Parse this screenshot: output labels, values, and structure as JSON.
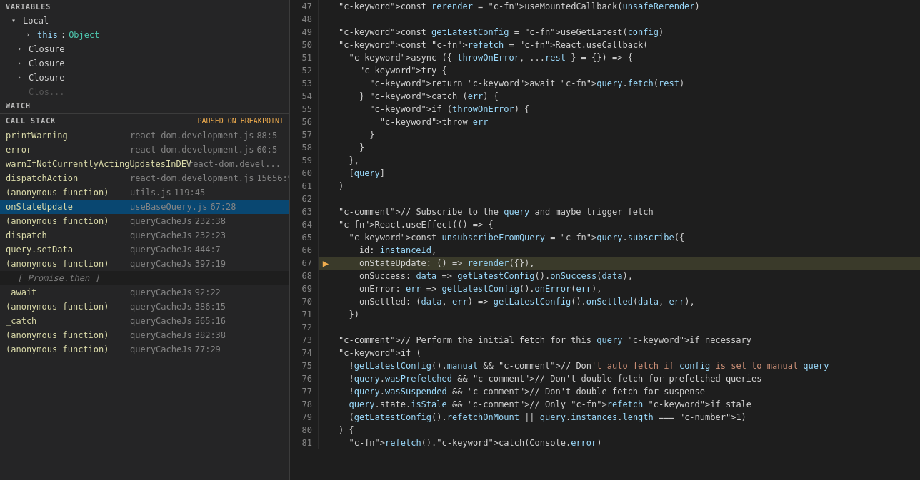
{
  "leftPanel": {
    "variablesHeader": "VARIABLES",
    "watchHeader": "WATCH",
    "localLabel": "Local",
    "thisLabel": "this",
    "thisType": "Object",
    "closureLabels": [
      "Closure",
      "Closure",
      "Closure"
    ],
    "callStackHeader": "CALL STACK",
    "pausedLabel": "PAUSED ON BREAKPOINT",
    "stackItems": [
      {
        "fn": "printWarning",
        "file": "react-dom.development.js",
        "line": "88:5",
        "selected": false,
        "separator": false
      },
      {
        "fn": "error",
        "file": "react-dom.development.js",
        "line": "60:5",
        "selected": false,
        "separator": false
      },
      {
        "fn": "warnIfNotCurrentlyActingUpdatesInDEV",
        "file": "react-dom.devel...",
        "line": "",
        "selected": false,
        "separator": false
      },
      {
        "fn": "dispatchAction",
        "file": "react-dom.development.js",
        "line": "15656:9",
        "selected": false,
        "separator": false
      },
      {
        "fn": "(anonymous function)",
        "file": "utils.js",
        "line": "119:45",
        "selected": false,
        "separator": false
      },
      {
        "fn": "onStateUpdate",
        "file": "useBaseQuery.js",
        "line": "67:28",
        "selected": true,
        "separator": false
      },
      {
        "fn": "(anonymous function)",
        "file": "queryCacheJs",
        "line": "232:38",
        "selected": false,
        "separator": false
      },
      {
        "fn": "dispatch",
        "file": "queryCacheJs",
        "line": "232:23",
        "selected": false,
        "separator": false
      },
      {
        "fn": "query.setData",
        "file": "queryCacheJs",
        "line": "444:7",
        "selected": false,
        "separator": false
      },
      {
        "fn": "(anonymous function)",
        "file": "queryCacheJs",
        "line": "397:19",
        "selected": false,
        "separator": false
      },
      {
        "fn": "[ Promise.then ]",
        "file": "",
        "line": "",
        "selected": false,
        "separator": true
      },
      {
        "fn": "_await",
        "file": "queryCacheJs",
        "line": "92:22",
        "selected": false,
        "separator": false
      },
      {
        "fn": "(anonymous function)",
        "file": "queryCacheJs",
        "line": "386:15",
        "selected": false,
        "separator": false
      },
      {
        "fn": "_catch",
        "file": "queryCacheJs",
        "line": "565:16",
        "selected": false,
        "separator": false
      },
      {
        "fn": "(anonymous function)",
        "file": "queryCacheJs",
        "line": "382:38",
        "selected": false,
        "separator": false
      },
      {
        "fn": "(anonymous function)",
        "file": "queryCacheJs",
        "line": "77:29",
        "selected": false,
        "separator": false
      }
    ]
  },
  "editor": {
    "lines": [
      {
        "num": 47,
        "content": "const rerender = useMountedCallback(unsafeRerender)",
        "active": false,
        "breakpoint": false
      },
      {
        "num": 48,
        "content": "",
        "active": false,
        "breakpoint": false
      },
      {
        "num": 49,
        "content": "const getLatestConfig = useGetLatest(config)",
        "active": false,
        "breakpoint": false
      },
      {
        "num": 50,
        "content": "const refetch = React.useCallback(",
        "active": false,
        "breakpoint": false
      },
      {
        "num": 51,
        "content": "  async ({ throwOnError, ...rest } = {}) => {",
        "active": false,
        "breakpoint": false
      },
      {
        "num": 52,
        "content": "    try {",
        "active": false,
        "breakpoint": false
      },
      {
        "num": 53,
        "content": "      return await query.fetch(rest)",
        "active": false,
        "breakpoint": false
      },
      {
        "num": 54,
        "content": "    } catch (err) {",
        "active": false,
        "breakpoint": false
      },
      {
        "num": 55,
        "content": "      if (throwOnError) {",
        "active": false,
        "breakpoint": false
      },
      {
        "num": 56,
        "content": "        throw err",
        "active": false,
        "breakpoint": false
      },
      {
        "num": 57,
        "content": "      }",
        "active": false,
        "breakpoint": false
      },
      {
        "num": 58,
        "content": "    }",
        "active": false,
        "breakpoint": false
      },
      {
        "num": 59,
        "content": "  },",
        "active": false,
        "breakpoint": false
      },
      {
        "num": 60,
        "content": "  [query]",
        "active": false,
        "breakpoint": false
      },
      {
        "num": 61,
        "content": ")",
        "active": false,
        "breakpoint": false
      },
      {
        "num": 62,
        "content": "",
        "active": false,
        "breakpoint": false
      },
      {
        "num": 63,
        "content": "// Subscribe to the query and maybe trigger fetch",
        "active": false,
        "breakpoint": false
      },
      {
        "num": 64,
        "content": "React.useEffect(() => {",
        "active": false,
        "breakpoint": false
      },
      {
        "num": 65,
        "content": "  const unsubscribeFromQuery = query.subscribe({",
        "active": false,
        "breakpoint": false
      },
      {
        "num": 66,
        "content": "    id: instanceId,",
        "active": false,
        "breakpoint": false
      },
      {
        "num": 67,
        "content": "    onStateUpdate: () => rerender({}),",
        "active": true,
        "breakpoint": true
      },
      {
        "num": 68,
        "content": "    onSuccess: data => getLatestConfig().onSuccess(data),",
        "active": false,
        "breakpoint": false
      },
      {
        "num": 69,
        "content": "    onError: err => getLatestConfig().onError(err),",
        "active": false,
        "breakpoint": false
      },
      {
        "num": 70,
        "content": "    onSettled: (data, err) => getLatestConfig().onSettled(data, err),",
        "active": false,
        "breakpoint": false
      },
      {
        "num": 71,
        "content": "  })",
        "active": false,
        "breakpoint": false
      },
      {
        "num": 72,
        "content": "",
        "active": false,
        "breakpoint": false
      },
      {
        "num": 73,
        "content": "// Perform the initial fetch for this query if necessary",
        "active": false,
        "breakpoint": false
      },
      {
        "num": 74,
        "content": "if (",
        "active": false,
        "breakpoint": false
      },
      {
        "num": 75,
        "content": "  !getLatestConfig().manual && // Don't auto fetch if config is set to manual query",
        "active": false,
        "breakpoint": false
      },
      {
        "num": 76,
        "content": "  !query.wasPrefetched && // Don't double fetch for prefetched queries",
        "active": false,
        "breakpoint": false
      },
      {
        "num": 77,
        "content": "  !query.wasSuspended && // Don't double fetch for suspense",
        "active": false,
        "breakpoint": false
      },
      {
        "num": 78,
        "content": "  query.state.isStale && // Only refetch if stale",
        "active": false,
        "breakpoint": false
      },
      {
        "num": 79,
        "content": "  (getLatestConfig().refetchOnMount || query.instances.length === 1)",
        "active": false,
        "breakpoint": false
      },
      {
        "num": 80,
        "content": ") {",
        "active": false,
        "breakpoint": false
      },
      {
        "num": 81,
        "content": "  refetch().catch(Console.error)",
        "active": false,
        "breakpoint": false
      }
    ]
  }
}
